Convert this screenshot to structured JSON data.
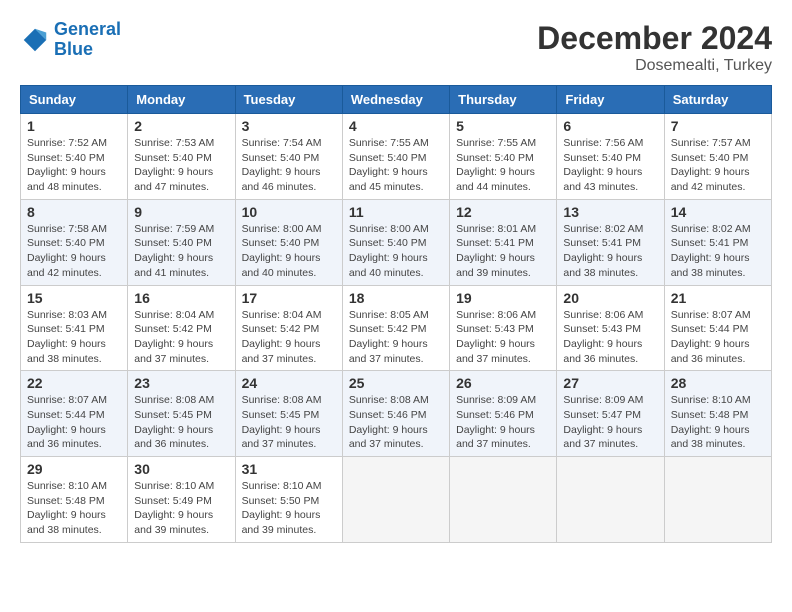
{
  "header": {
    "logo_line1": "General",
    "logo_line2": "Blue",
    "month": "December 2024",
    "location": "Dosemealti, Turkey"
  },
  "weekdays": [
    "Sunday",
    "Monday",
    "Tuesday",
    "Wednesday",
    "Thursday",
    "Friday",
    "Saturday"
  ],
  "weeks": [
    [
      {
        "day": "1",
        "sunrise": "Sunrise: 7:52 AM",
        "sunset": "Sunset: 5:40 PM",
        "daylight": "Daylight: 9 hours and 48 minutes."
      },
      {
        "day": "2",
        "sunrise": "Sunrise: 7:53 AM",
        "sunset": "Sunset: 5:40 PM",
        "daylight": "Daylight: 9 hours and 47 minutes."
      },
      {
        "day": "3",
        "sunrise": "Sunrise: 7:54 AM",
        "sunset": "Sunset: 5:40 PM",
        "daylight": "Daylight: 9 hours and 46 minutes."
      },
      {
        "day": "4",
        "sunrise": "Sunrise: 7:55 AM",
        "sunset": "Sunset: 5:40 PM",
        "daylight": "Daylight: 9 hours and 45 minutes."
      },
      {
        "day": "5",
        "sunrise": "Sunrise: 7:55 AM",
        "sunset": "Sunset: 5:40 PM",
        "daylight": "Daylight: 9 hours and 44 minutes."
      },
      {
        "day": "6",
        "sunrise": "Sunrise: 7:56 AM",
        "sunset": "Sunset: 5:40 PM",
        "daylight": "Daylight: 9 hours and 43 minutes."
      },
      {
        "day": "7",
        "sunrise": "Sunrise: 7:57 AM",
        "sunset": "Sunset: 5:40 PM",
        "daylight": "Daylight: 9 hours and 42 minutes."
      }
    ],
    [
      {
        "day": "8",
        "sunrise": "Sunrise: 7:58 AM",
        "sunset": "Sunset: 5:40 PM",
        "daylight": "Daylight: 9 hours and 42 minutes."
      },
      {
        "day": "9",
        "sunrise": "Sunrise: 7:59 AM",
        "sunset": "Sunset: 5:40 PM",
        "daylight": "Daylight: 9 hours and 41 minutes."
      },
      {
        "day": "10",
        "sunrise": "Sunrise: 8:00 AM",
        "sunset": "Sunset: 5:40 PM",
        "daylight": "Daylight: 9 hours and 40 minutes."
      },
      {
        "day": "11",
        "sunrise": "Sunrise: 8:00 AM",
        "sunset": "Sunset: 5:40 PM",
        "daylight": "Daylight: 9 hours and 40 minutes."
      },
      {
        "day": "12",
        "sunrise": "Sunrise: 8:01 AM",
        "sunset": "Sunset: 5:41 PM",
        "daylight": "Daylight: 9 hours and 39 minutes."
      },
      {
        "day": "13",
        "sunrise": "Sunrise: 8:02 AM",
        "sunset": "Sunset: 5:41 PM",
        "daylight": "Daylight: 9 hours and 38 minutes."
      },
      {
        "day": "14",
        "sunrise": "Sunrise: 8:02 AM",
        "sunset": "Sunset: 5:41 PM",
        "daylight": "Daylight: 9 hours and 38 minutes."
      }
    ],
    [
      {
        "day": "15",
        "sunrise": "Sunrise: 8:03 AM",
        "sunset": "Sunset: 5:41 PM",
        "daylight": "Daylight: 9 hours and 38 minutes."
      },
      {
        "day": "16",
        "sunrise": "Sunrise: 8:04 AM",
        "sunset": "Sunset: 5:42 PM",
        "daylight": "Daylight: 9 hours and 37 minutes."
      },
      {
        "day": "17",
        "sunrise": "Sunrise: 8:04 AM",
        "sunset": "Sunset: 5:42 PM",
        "daylight": "Daylight: 9 hours and 37 minutes."
      },
      {
        "day": "18",
        "sunrise": "Sunrise: 8:05 AM",
        "sunset": "Sunset: 5:42 PM",
        "daylight": "Daylight: 9 hours and 37 minutes."
      },
      {
        "day": "19",
        "sunrise": "Sunrise: 8:06 AM",
        "sunset": "Sunset: 5:43 PM",
        "daylight": "Daylight: 9 hours and 37 minutes."
      },
      {
        "day": "20",
        "sunrise": "Sunrise: 8:06 AM",
        "sunset": "Sunset: 5:43 PM",
        "daylight": "Daylight: 9 hours and 36 minutes."
      },
      {
        "day": "21",
        "sunrise": "Sunrise: 8:07 AM",
        "sunset": "Sunset: 5:44 PM",
        "daylight": "Daylight: 9 hours and 36 minutes."
      }
    ],
    [
      {
        "day": "22",
        "sunrise": "Sunrise: 8:07 AM",
        "sunset": "Sunset: 5:44 PM",
        "daylight": "Daylight: 9 hours and 36 minutes."
      },
      {
        "day": "23",
        "sunrise": "Sunrise: 8:08 AM",
        "sunset": "Sunset: 5:45 PM",
        "daylight": "Daylight: 9 hours and 36 minutes."
      },
      {
        "day": "24",
        "sunrise": "Sunrise: 8:08 AM",
        "sunset": "Sunset: 5:45 PM",
        "daylight": "Daylight: 9 hours and 37 minutes."
      },
      {
        "day": "25",
        "sunrise": "Sunrise: 8:08 AM",
        "sunset": "Sunset: 5:46 PM",
        "daylight": "Daylight: 9 hours and 37 minutes."
      },
      {
        "day": "26",
        "sunrise": "Sunrise: 8:09 AM",
        "sunset": "Sunset: 5:46 PM",
        "daylight": "Daylight: 9 hours and 37 minutes."
      },
      {
        "day": "27",
        "sunrise": "Sunrise: 8:09 AM",
        "sunset": "Sunset: 5:47 PM",
        "daylight": "Daylight: 9 hours and 37 minutes."
      },
      {
        "day": "28",
        "sunrise": "Sunrise: 8:10 AM",
        "sunset": "Sunset: 5:48 PM",
        "daylight": "Daylight: 9 hours and 38 minutes."
      }
    ],
    [
      {
        "day": "29",
        "sunrise": "Sunrise: 8:10 AM",
        "sunset": "Sunset: 5:48 PM",
        "daylight": "Daylight: 9 hours and 38 minutes."
      },
      {
        "day": "30",
        "sunrise": "Sunrise: 8:10 AM",
        "sunset": "Sunset: 5:49 PM",
        "daylight": "Daylight: 9 hours and 39 minutes."
      },
      {
        "day": "31",
        "sunrise": "Sunrise: 8:10 AM",
        "sunset": "Sunset: 5:50 PM",
        "daylight": "Daylight: 9 hours and 39 minutes."
      },
      null,
      null,
      null,
      null
    ]
  ]
}
